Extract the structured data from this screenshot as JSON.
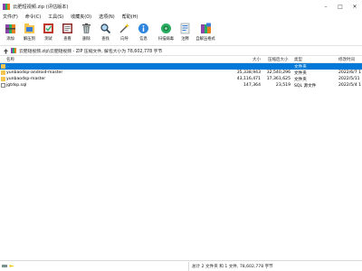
{
  "window": {
    "title": "云肥短视频.zip (评估版本)",
    "minimize": "–",
    "maximize": "□",
    "close": "✕"
  },
  "menu": [
    "文件(F)",
    "命令(C)",
    "工具(S)",
    "收藏夹(O)",
    "选项(N)",
    "帮助(H)"
  ],
  "toolbar": [
    {
      "label": "添加",
      "icon": "add-archive-icon"
    },
    {
      "label": "解压到",
      "icon": "extract-to-icon"
    },
    {
      "label": "测试",
      "icon": "test-icon"
    },
    {
      "label": "查看",
      "icon": "view-icon"
    },
    {
      "label": "删除",
      "icon": "delete-icon"
    },
    {
      "label": "查找",
      "icon": "find-icon"
    },
    {
      "label": "向导",
      "icon": "wizard-icon"
    },
    {
      "label": "信息",
      "icon": "info-icon"
    },
    {
      "label": "扫描病毒",
      "icon": "virus-scan-icon"
    },
    {
      "label": "注释",
      "icon": "comment-icon"
    },
    {
      "label": "自解压格式",
      "icon": "sfx-icon"
    }
  ],
  "address": {
    "path": "云肥短视频.zip\\云肥短视频 - ZIP 压缩文件, 解包大小为 78,602,778 字节"
  },
  "columns": {
    "name": "名称",
    "size": "大小",
    "packed": "压缩后大小",
    "type": "类型",
    "modified": "修改时间"
  },
  "rows": [
    {
      "name": "..",
      "size": "",
      "packed": "",
      "type": "文件夹",
      "modified": "",
      "icon": "parent-folder-icon",
      "selected": true
    },
    {
      "name": "yunbaodsp-android-master",
      "size": "35,338,943",
      "packed": "32,540,296",
      "type": "文件夹",
      "modified": "2022/6/7 1",
      "icon": "folder-icon",
      "selected": false
    },
    {
      "name": "yunbaodsp-master",
      "size": "43,116,471",
      "packed": "17,361,625",
      "type": "文件夹",
      "modified": "2022/5/11",
      "icon": "folder-icon",
      "selected": false
    },
    {
      "name": "jgtdsp.sql",
      "size": "147,364",
      "packed": "23,519",
      "type": "SQL 源文件",
      "modified": "2022/5/4 1",
      "icon": "sql-file-icon",
      "selected": false
    }
  ],
  "status": {
    "text": "总计 2 文件夹 和 1 文件, 78,602,778 字节"
  },
  "colors": {
    "selection": "#0078d7",
    "folder": "#f6c550"
  }
}
